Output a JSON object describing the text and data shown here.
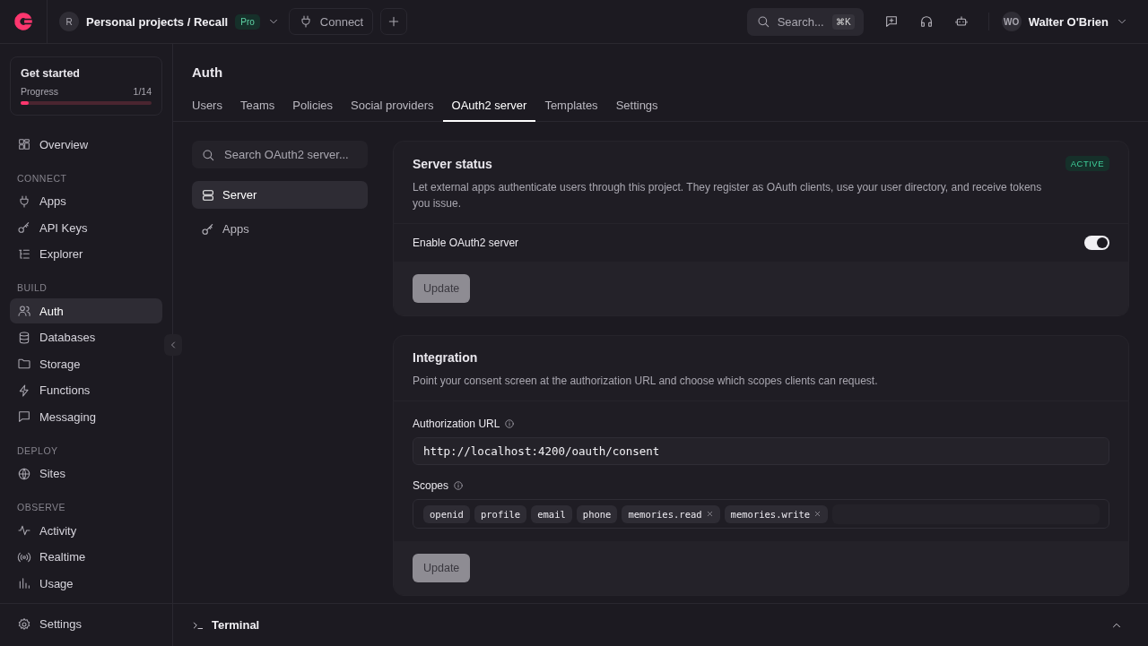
{
  "topbar": {
    "project": {
      "avatar": "R",
      "name": "Personal projects / Recall",
      "plan": "Pro"
    },
    "connect": "Connect",
    "search": {
      "placeholder": "Search...",
      "shortcut": "⌘K"
    },
    "user": {
      "initials": "WO",
      "name": "Walter O'Brien"
    }
  },
  "sidebar": {
    "get_started": {
      "title": "Get started",
      "label": "Progress",
      "count": "1/14",
      "level": 0.06
    },
    "nav": [
      {
        "kind": "item",
        "label": "Overview",
        "selected": false
      },
      {
        "kind": "section",
        "label": "CONNECT"
      },
      {
        "kind": "item",
        "label": "Apps",
        "selected": false
      },
      {
        "kind": "item",
        "label": "API Keys",
        "selected": false
      },
      {
        "kind": "item",
        "label": "Explorer",
        "selected": false
      },
      {
        "kind": "section",
        "label": "BUILD"
      },
      {
        "kind": "item",
        "label": "Auth",
        "selected": true
      },
      {
        "kind": "item",
        "label": "Databases",
        "selected": false
      },
      {
        "kind": "item",
        "label": "Storage",
        "selected": false
      },
      {
        "kind": "item",
        "label": "Functions",
        "selected": false
      },
      {
        "kind": "item",
        "label": "Messaging",
        "selected": false
      },
      {
        "kind": "section",
        "label": "DEPLOY"
      },
      {
        "kind": "item",
        "label": "Sites",
        "selected": false
      },
      {
        "kind": "section",
        "label": "OBSERVE"
      },
      {
        "kind": "item",
        "label": "Activity",
        "selected": false
      },
      {
        "kind": "item",
        "label": "Realtime",
        "selected": false
      },
      {
        "kind": "item",
        "label": "Usage",
        "selected": false
      }
    ],
    "footer": "Settings"
  },
  "page": {
    "title": "Auth",
    "tabs": [
      {
        "label": "Users",
        "selected": false
      },
      {
        "label": "Teams",
        "selected": false
      },
      {
        "label": "Policies",
        "selected": false
      },
      {
        "label": "Social providers",
        "selected": false
      },
      {
        "label": "OAuth2 server",
        "selected": true
      },
      {
        "label": "Templates",
        "selected": false
      },
      {
        "label": "Settings",
        "selected": false
      }
    ],
    "subnav": {
      "search": {
        "placeholder": "Search OAuth2 server..."
      },
      "items": [
        {
          "label": "Server",
          "selected": true
        },
        {
          "label": "Apps",
          "selected": false
        }
      ]
    },
    "server_status": {
      "title": "Server status",
      "status": "ACTIVE",
      "description": "Let external apps authenticate users through this project. They register as OAuth clients, use your user directory, and receive tokens you issue.",
      "toggle": {
        "label": "Enable OAuth2 server",
        "on": true
      },
      "button": "Update"
    },
    "integration": {
      "title": "Integration",
      "description": "Point your consent screen at the authorization URL and choose which scopes clients can request.",
      "url_label": "Authorization URL",
      "url": "http://localhost:4200/oauth/consent",
      "scopes_label": "Scopes",
      "scopes": [
        {
          "label": "openid",
          "removable": false
        },
        {
          "label": "profile",
          "removable": false
        },
        {
          "label": "email",
          "removable": false
        },
        {
          "label": "phone",
          "removable": false
        },
        {
          "label": "memories.read",
          "removable": true
        },
        {
          "label": "memories.write",
          "removable": true
        }
      ],
      "button": "Update"
    }
  },
  "terminal": {
    "label": "Terminal"
  }
}
